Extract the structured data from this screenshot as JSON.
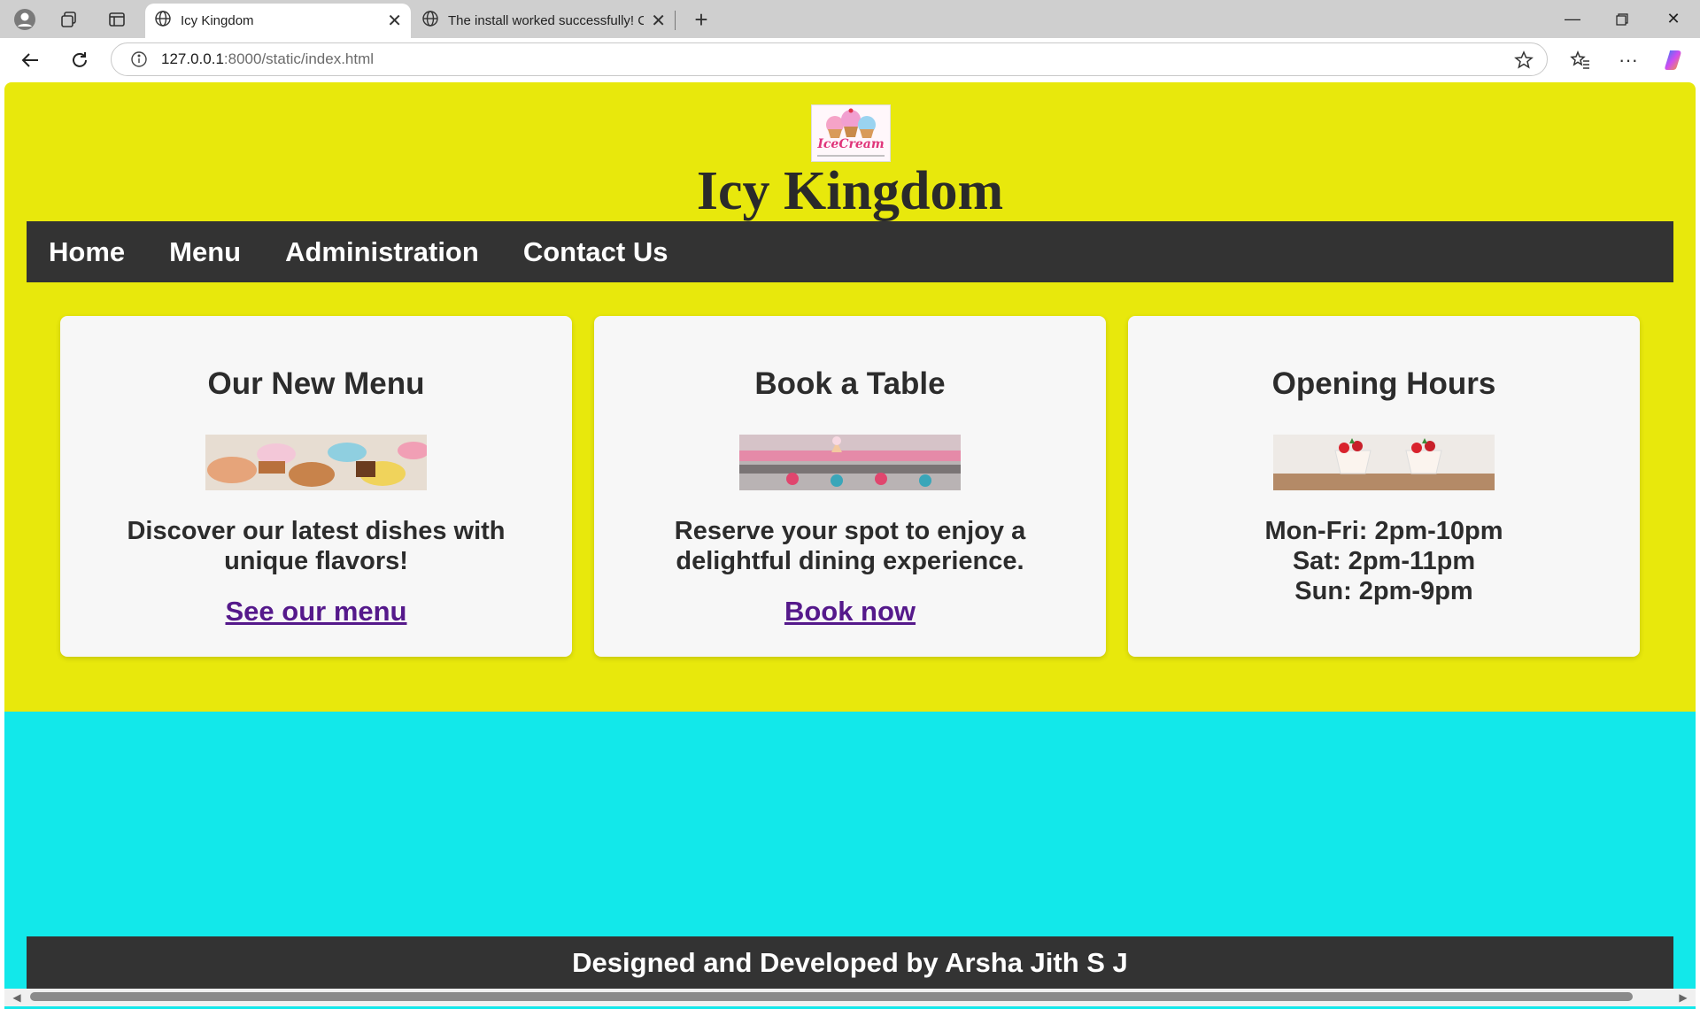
{
  "browser": {
    "tabs": [
      {
        "title": "Icy Kingdom",
        "active": true
      },
      {
        "title": "The install worked successfully! Co",
        "active": false
      }
    ],
    "url_host": "127.0.0.1",
    "url_rest": ":8000/static/index.html"
  },
  "site": {
    "logo_text": "IceCream",
    "title": "Icy Kingdom",
    "nav": [
      "Home",
      "Menu",
      "Administration",
      "Contact Us"
    ]
  },
  "cards": [
    {
      "heading": "Our New Menu",
      "text": "Discover our latest dishes with unique flavors!",
      "link": "See our menu"
    },
    {
      "heading": "Book a Table",
      "text": "Reserve your spot to enjoy a delightful dining experience.",
      "link": "Book now"
    },
    {
      "heading": "Opening Hours",
      "hours": [
        "Mon-Fri: 2pm-10pm",
        "Sat: 2pm-11pm",
        "Sun: 2pm-9pm"
      ]
    }
  ],
  "footer": "Designed and Developed by Arsha Jith S J",
  "colors": {
    "hero_bg": "#e8e80c",
    "lower_bg": "#12e8ea",
    "nav_bg": "#333333",
    "link": "#55198b"
  }
}
